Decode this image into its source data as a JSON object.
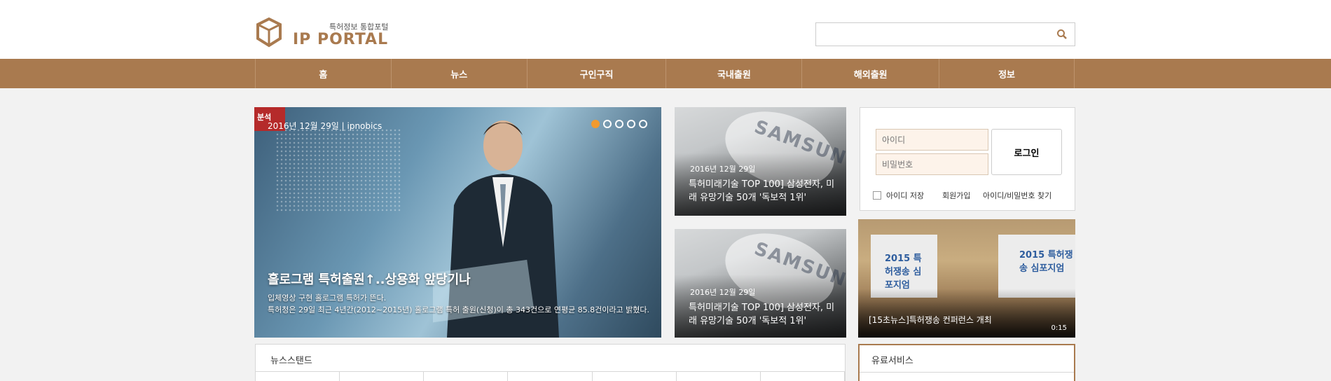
{
  "header": {
    "logo_tagline": "특허정보 통합포털",
    "logo_text": "IP PORTAL",
    "search_placeholder": "",
    "search_icon": "search-icon"
  },
  "nav": {
    "items": [
      "홈",
      "뉴스",
      "구인구직",
      "국내출원",
      "해외출원",
      "정보"
    ]
  },
  "hero": {
    "tag": "분석",
    "date": "2016년 12월 29일 | ipnobics",
    "title": "홀로그램 특허출원↑..상용화 앞당기나",
    "sub1": "입체영상 구현 홀로그램 특허가 뜬다.",
    "sub2": "특허청은 29일 최근 4년간(2012~2015년) 홀로그램 특허 출원(신청)이 총 343건으로 연평균 85.8건이라고 밝혔다.",
    "active_dot": 1,
    "dot_count": 5
  },
  "cards": [
    {
      "date": "2016년 12월 29일",
      "title": "특허미래기술 TOP 100] 삼성전자, 미래 유망기술 50개 '독보적 1위'"
    },
    {
      "date": "2016년 12월 29일",
      "title": "특허미래기술 TOP 100] 삼성전자, 미래 유망기술 50개 '독보적 1위'"
    }
  ],
  "login": {
    "id_placeholder": "아이디",
    "pw_placeholder": "비밀번호",
    "login_label": "로그인",
    "remember_label": "아이디 저장",
    "signup_label": "회원가입",
    "find_label": "아이디/비밀번호 찾기"
  },
  "video": {
    "title": "[15초뉴스]특허쟁송 컨퍼런스 개최",
    "duration": "0:15",
    "screen_text_left": "2015 특허쟁송 심포지엄",
    "screen_text_right": "2015 특허쟁송 심포지엄"
  },
  "newsstand": {
    "title": "뉴스스탠드"
  },
  "paid": {
    "title": "유료서비스"
  },
  "colors": {
    "brand": "#a97a4f",
    "accent": "#f29a2e"
  }
}
